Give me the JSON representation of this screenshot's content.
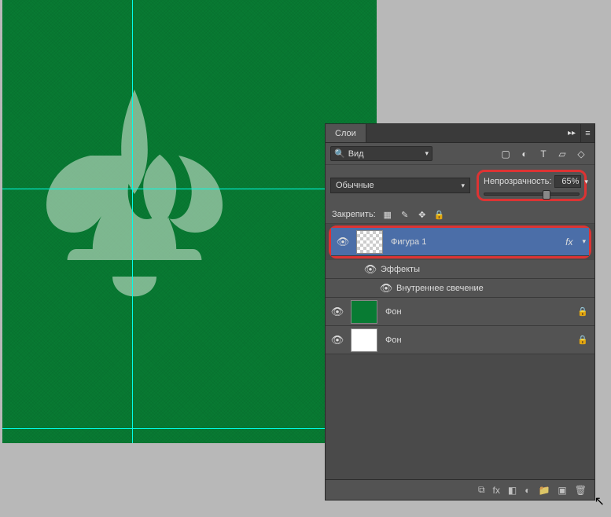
{
  "panel": {
    "title": "Слои",
    "search_label": "Вид",
    "blend_mode": "Обычные",
    "opacity_label": "Непрозрачность:",
    "opacity_value": "65%",
    "lock_label": "Закрепить:"
  },
  "layers": [
    {
      "name": "Фигура 1",
      "selected": true,
      "has_fx": true,
      "thumb": "checker"
    },
    {
      "name": "Фон",
      "selected": false,
      "has_lock": true,
      "thumb": "green"
    },
    {
      "name": "Фон",
      "selected": false,
      "has_lock": true,
      "thumb": "white"
    }
  ],
  "effects": {
    "title": "Эффекты",
    "items": [
      "Внутреннее свечение"
    ]
  },
  "icons": {
    "eye": "👁",
    "image": "▢",
    "adjust": "◐",
    "text": "T",
    "crop": "▱",
    "path": "◇",
    "link": "⧉",
    "search": "🔍",
    "pixel": "▦",
    "brush": "✎",
    "move": "✥",
    "lock": "🔒",
    "fx": "fx",
    "chain": "⧉",
    "mask": "◧",
    "folder": "📁",
    "new": "▣",
    "trash": "🗑",
    "chevron": "▾",
    "expand": "▸",
    "collapse": "▸▸",
    "menu": "≡"
  }
}
